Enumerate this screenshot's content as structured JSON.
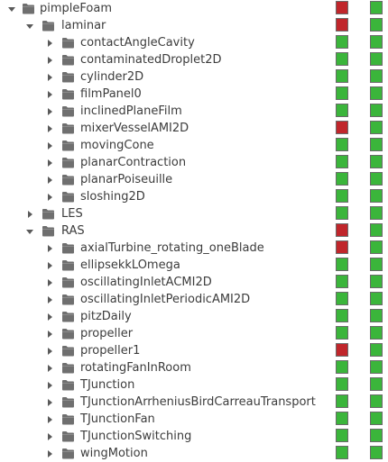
{
  "colors": {
    "pass": "#3bb53b",
    "fail": "#c0262b",
    "folder": "#6f6f6f",
    "text": "#3c3c3c"
  },
  "icons": {
    "expanded": "chevron-down-icon",
    "collapsed": "chevron-right-icon",
    "item": "folder-icon"
  },
  "rows": [
    {
      "label": "pimpleFoam",
      "depth": 0,
      "state": "expanded",
      "status": [
        "fail",
        "pass"
      ]
    },
    {
      "label": "laminar",
      "depth": 1,
      "state": "expanded",
      "status": [
        "fail",
        "pass"
      ]
    },
    {
      "label": "contactAngleCavity",
      "depth": 2,
      "state": "collapsed",
      "status": [
        "pass",
        "pass"
      ]
    },
    {
      "label": "contaminatedDroplet2D",
      "depth": 2,
      "state": "collapsed",
      "status": [
        "pass",
        "pass"
      ]
    },
    {
      "label": "cylinder2D",
      "depth": 2,
      "state": "collapsed",
      "status": [
        "pass",
        "pass"
      ]
    },
    {
      "label": "filmPanel0",
      "depth": 2,
      "state": "collapsed",
      "status": [
        "pass",
        "pass"
      ]
    },
    {
      "label": "inclinedPlaneFilm",
      "depth": 2,
      "state": "collapsed",
      "status": [
        "pass",
        "pass"
      ]
    },
    {
      "label": "mixerVesselAMI2D",
      "depth": 2,
      "state": "collapsed",
      "status": [
        "fail",
        "pass"
      ]
    },
    {
      "label": "movingCone",
      "depth": 2,
      "state": "collapsed",
      "status": [
        "pass",
        "pass"
      ]
    },
    {
      "label": "planarContraction",
      "depth": 2,
      "state": "collapsed",
      "status": [
        "pass",
        "pass"
      ]
    },
    {
      "label": "planarPoiseuille",
      "depth": 2,
      "state": "collapsed",
      "status": [
        "pass",
        "pass"
      ]
    },
    {
      "label": "sloshing2D",
      "depth": 2,
      "state": "collapsed",
      "status": [
        "pass",
        "pass"
      ]
    },
    {
      "label": "LES",
      "depth": 1,
      "state": "collapsed",
      "status": [
        "pass",
        "pass"
      ]
    },
    {
      "label": "RAS",
      "depth": 1,
      "state": "expanded",
      "status": [
        "fail",
        "pass"
      ]
    },
    {
      "label": "axialTurbine_rotating_oneBlade",
      "depth": 2,
      "state": "collapsed",
      "status": [
        "fail",
        "pass"
      ]
    },
    {
      "label": "ellipsekkLOmega",
      "depth": 2,
      "state": "collapsed",
      "status": [
        "pass",
        "pass"
      ]
    },
    {
      "label": "oscillatingInletACMI2D",
      "depth": 2,
      "state": "collapsed",
      "status": [
        "pass",
        "pass"
      ]
    },
    {
      "label": "oscillatingInletPeriodicAMI2D",
      "depth": 2,
      "state": "collapsed",
      "status": [
        "pass",
        "pass"
      ]
    },
    {
      "label": "pitzDaily",
      "depth": 2,
      "state": "collapsed",
      "status": [
        "pass",
        "pass"
      ]
    },
    {
      "label": "propeller",
      "depth": 2,
      "state": "collapsed",
      "status": [
        "pass",
        "pass"
      ]
    },
    {
      "label": "propeller1",
      "depth": 2,
      "state": "collapsed",
      "status": [
        "fail",
        "pass"
      ]
    },
    {
      "label": "rotatingFanInRoom",
      "depth": 2,
      "state": "collapsed",
      "status": [
        "pass",
        "pass"
      ]
    },
    {
      "label": "TJunction",
      "depth": 2,
      "state": "collapsed",
      "status": [
        "pass",
        "pass"
      ]
    },
    {
      "label": "TJunctionArrheniusBirdCarreauTransport",
      "depth": 2,
      "state": "collapsed",
      "status": [
        "pass",
        "pass"
      ]
    },
    {
      "label": "TJunctionFan",
      "depth": 2,
      "state": "collapsed",
      "status": [
        "pass",
        "pass"
      ]
    },
    {
      "label": "TJunctionSwitching",
      "depth": 2,
      "state": "collapsed",
      "status": [
        "pass",
        "pass"
      ]
    },
    {
      "label": "wingMotion",
      "depth": 2,
      "state": "collapsed",
      "status": [
        "pass",
        "pass"
      ]
    }
  ]
}
